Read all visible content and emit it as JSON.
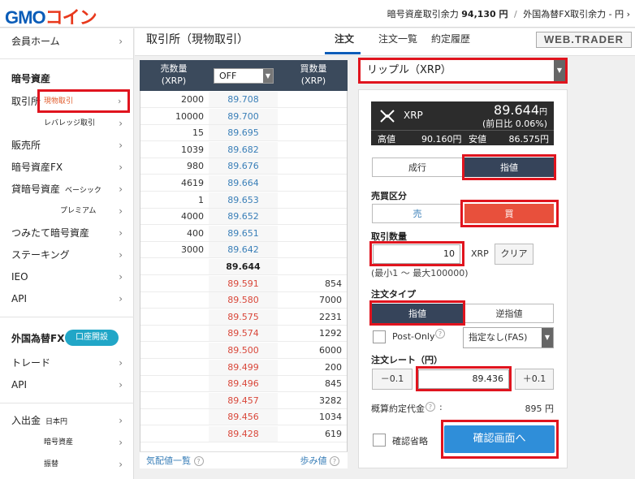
{
  "header": {
    "logo_main": "GMO",
    "logo_accent": "コイン",
    "balance_label1": "暗号資産取引余力",
    "balance_value1": "94,130 円",
    "separator": "/",
    "balance_label2": "外国為替FX取引余力 - 円",
    "balance_chev": "›"
  },
  "sidebar": {
    "home": "会員ホーム",
    "crypto_heading": "暗号資産",
    "exchange": "取引所",
    "spot": "現物取引",
    "leverage": "レバレッジ取引",
    "sales": "販売所",
    "crypto_fx": "暗号資産FX",
    "lending": "貸暗号資産",
    "basic": "ベーシック",
    "premium": "プレミアム",
    "tsumitate": "つみたて暗号資産",
    "staking": "ステーキング",
    "ieo": "IEO",
    "api": "API",
    "fx_heading": "外国為替FX",
    "open_account": "口座開設",
    "trade": "トレード",
    "api2": "API",
    "deposit": "入出金",
    "jpy": "日本円",
    "crypto_asset": "暗号資産",
    "transfer": "振替",
    "chev": "›"
  },
  "titlebar": {
    "title": "取引所（現物取引）",
    "tabs": [
      "注文",
      "注文一覧",
      "約定履歴"
    ],
    "webtrader": "WEB.TRADER"
  },
  "orderbook": {
    "sell_header": "売数量\n(XRP)",
    "sell_header_1": "売数量",
    "sell_header_2": "(XRP)",
    "buy_header_1": "買数量",
    "buy_header_2": "(XRP)",
    "grouping": "OFF",
    "asks": [
      {
        "amount": "2000",
        "price": "89.708"
      },
      {
        "amount": "10000",
        "price": "89.700"
      },
      {
        "amount": "15",
        "price": "89.695"
      },
      {
        "amount": "1039",
        "price": "89.682"
      },
      {
        "amount": "980",
        "price": "89.676"
      },
      {
        "amount": "4619",
        "price": "89.664"
      },
      {
        "amount": "1",
        "price": "89.653"
      },
      {
        "amount": "4000",
        "price": "89.652"
      },
      {
        "amount": "400",
        "price": "89.651"
      },
      {
        "amount": "3000",
        "price": "89.642"
      }
    ],
    "mid_price": "89.644",
    "bids": [
      {
        "price": "89.591",
        "amount": "854"
      },
      {
        "price": "89.580",
        "amount": "7000"
      },
      {
        "price": "89.575",
        "amount": "2231"
      },
      {
        "price": "89.574",
        "amount": "1292"
      },
      {
        "price": "89.500",
        "amount": "6000"
      },
      {
        "price": "89.499",
        "amount": "200"
      },
      {
        "price": "89.496",
        "amount": "845"
      },
      {
        "price": "89.457",
        "amount": "3282"
      },
      {
        "price": "89.456",
        "amount": "1034"
      },
      {
        "price": "89.428",
        "amount": "619"
      }
    ],
    "footer_left": "気配値一覧",
    "footer_right": "歩み値",
    "help": "?"
  },
  "order": {
    "pair": "リップル（XRP）",
    "ticker_symbol": "XRP",
    "ticker_price": "89.644",
    "ticker_unit": "円",
    "ticker_change": "(前日比 0.06%)",
    "high_label": "高値",
    "high_value": "90.160円",
    "low_label": "安値",
    "low_value": "86.575円",
    "market": "成行",
    "limit": "指値",
    "side_label": "売買区分",
    "sell": "売",
    "buy": "買",
    "qty_label": "取引数量",
    "qty_value": "10",
    "qty_unit": "XRP",
    "clear": "クリア",
    "qty_range": "(最小1 〜 最大100000)",
    "type_label": "注文タイプ",
    "type_limit": "指値",
    "type_stop": "逆指値",
    "post_only": "Post-Only",
    "tif": "指定なし(FAS)",
    "rate_label": "注文レート（円）",
    "minus": "－0.1",
    "rate_value": "89.436",
    "plus": "＋0.1",
    "est_label": "概算約定代金",
    "est_value": "895 円",
    "skip_confirm": "確認省略",
    "confirm": "確認画面へ",
    "help": "?"
  }
}
